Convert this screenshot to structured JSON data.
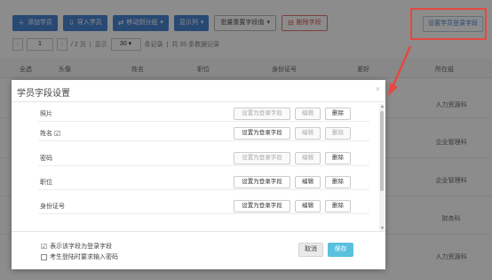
{
  "toolbar": {
    "add_student": "添加学员",
    "import_students": "导入学员",
    "move_group": "移动到分组",
    "display_columns": "显示列",
    "batch_reset": "批量重置字段值",
    "delete_field": "删除字段",
    "setting_login_field": "设置学员登录字段"
  },
  "pager": {
    "page_input": "1",
    "total_pages": "/ 2 页",
    "show_label": "显示",
    "page_size": "30",
    "per_page_suffix": "条记录",
    "total_records": "共 35 条数据记录"
  },
  "table": {
    "headers": [
      "全选",
      "头像",
      "姓名",
      "职位",
      "身份证号",
      "爱好",
      "所在组"
    ],
    "departments": [
      "人力资源科",
      "企业管理科",
      "企业管理科",
      "财务科",
      "人力资源科"
    ]
  },
  "dialog": {
    "title": "学员字段设置",
    "close": "×",
    "set_login_label": "设置为登录字段",
    "edit_label": "编辑",
    "delete_label": "删除",
    "fields": [
      {
        "name": "照片",
        "checked": false,
        "login_enabled": false,
        "edit_enabled": false,
        "delete_enabled": true
      },
      {
        "name": "姓名",
        "checked": true,
        "login_enabled": true,
        "edit_enabled": false,
        "delete_enabled": false
      },
      {
        "name": "密码",
        "checked": false,
        "login_enabled": false,
        "edit_enabled": false,
        "delete_enabled": true
      },
      {
        "name": "职位",
        "checked": false,
        "login_enabled": true,
        "edit_enabled": true,
        "delete_enabled": true
      },
      {
        "name": "身份证号",
        "checked": false,
        "login_enabled": true,
        "edit_enabled": true,
        "delete_enabled": true
      }
    ],
    "legend_text": "表示该字段为登录字段",
    "require_password_text": "考生登陆时要求输入密码",
    "cancel": "取消",
    "save": "保存"
  },
  "colors": {
    "accent_blue": "#4a86d2",
    "save_button": "#5bc0de",
    "highlight_red": "#e5483f"
  }
}
